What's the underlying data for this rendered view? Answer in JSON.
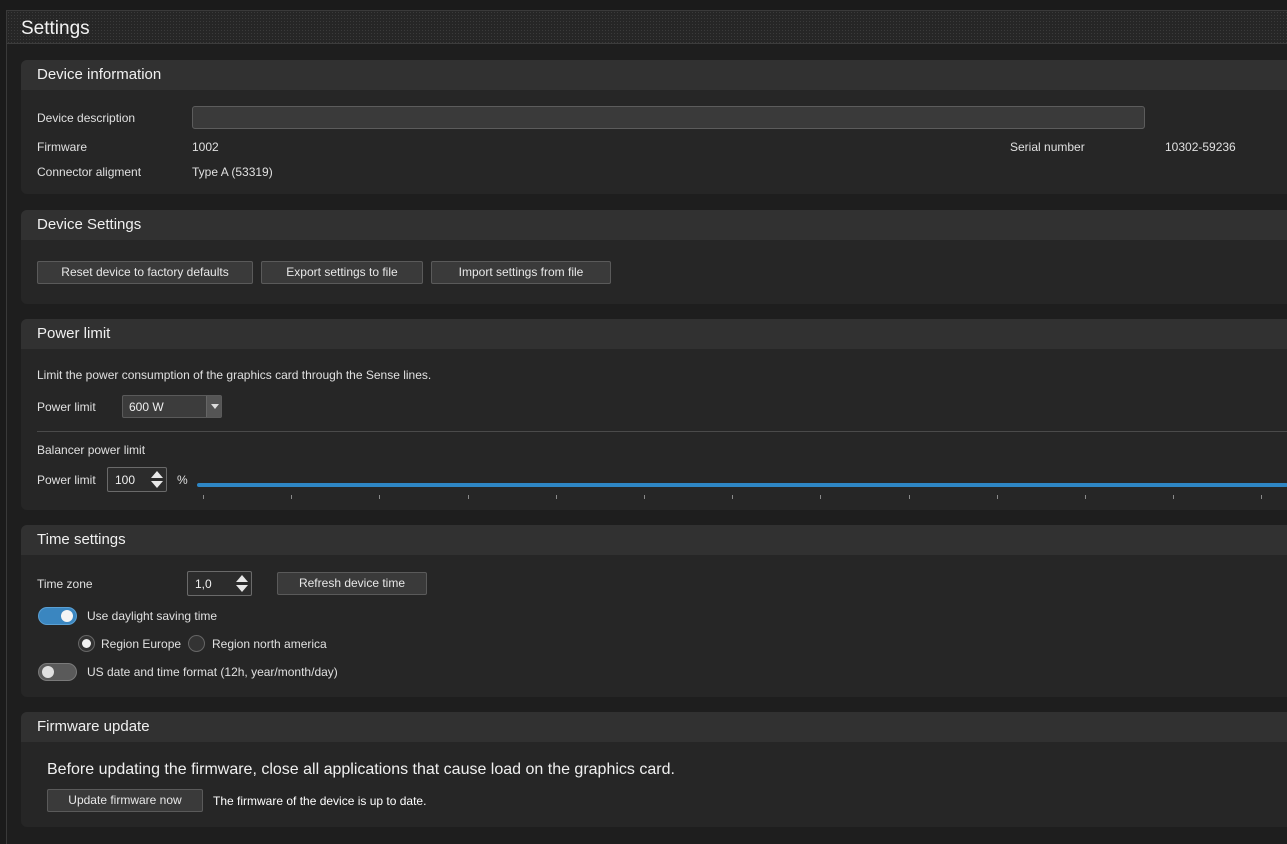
{
  "window": {
    "title": "Settings"
  },
  "device_information": {
    "header": "Device information",
    "description_label": "Device description",
    "description_value": "",
    "firmware_label": "Firmware",
    "firmware_value": "1002",
    "serial_label": "Serial number",
    "serial_value": "10302-59236",
    "connector_label": "Connector aligment",
    "connector_value": "Type A (53319)"
  },
  "device_settings": {
    "header": "Device Settings",
    "reset_button": "Reset device to factory defaults",
    "export_button": "Export settings to file",
    "import_button": "Import settings from file"
  },
  "power_limit": {
    "header": "Power limit",
    "description": "Limit the power consumption of the graphics card through the Sense lines.",
    "limit_label": "Power limit",
    "limit_selected": "600 W",
    "balancer_title": "Balancer power limit",
    "balancer_label": "Power limit",
    "balancer_value": "100",
    "balancer_unit": "%",
    "balancer_fraction": 1.0
  },
  "time_settings": {
    "header": "Time settings",
    "timezone_label": "Time zone",
    "timezone_value": "1,0",
    "refresh_button": "Refresh device time",
    "dst_label": "Use daylight saving time",
    "dst_enabled": true,
    "region_europe": "Region Europe",
    "region_na": "Region north america",
    "region_selected": "Region Europe",
    "us_format_label": "US date and time format (12h, year/month/day)",
    "us_format_enabled": false
  },
  "firmware_update": {
    "header": "Firmware update",
    "warning": "Before updating the firmware, close all applications that cause load on the graphics card.",
    "update_button": "Update firmware now",
    "status": "The firmware of the device is up to date."
  },
  "colors": {
    "accent": "#2e86c4",
    "background": "#1e1e1e",
    "panel": "#262626",
    "panel_header": "#313131"
  }
}
